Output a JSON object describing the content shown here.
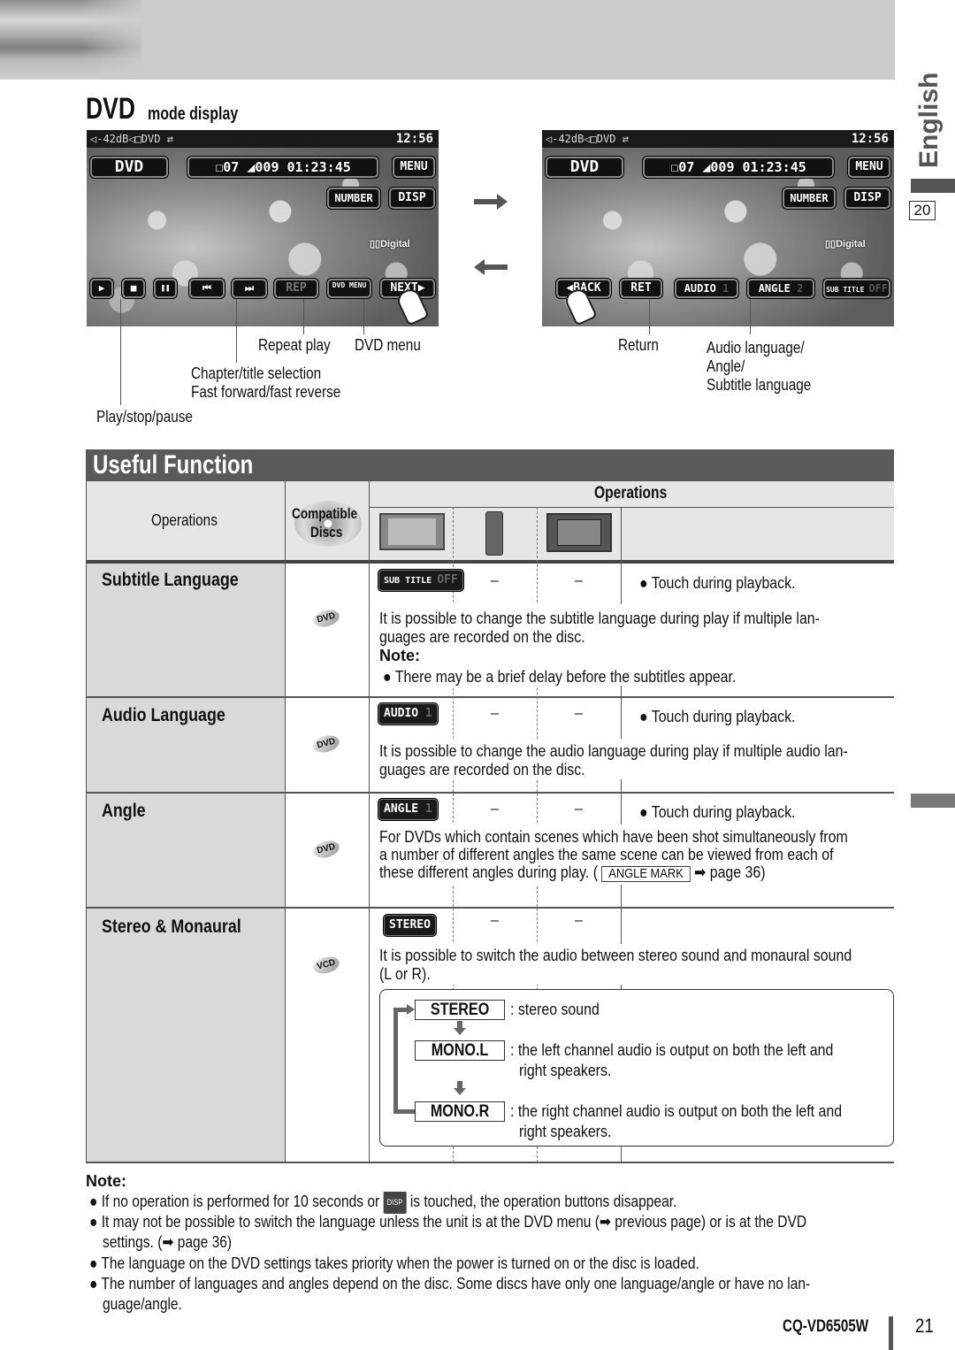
{
  "page": {
    "section_title": "DVD",
    "section_subtitle": "mode display",
    "side_tab_label": "English",
    "side_page_box": "20",
    "page_number": "21",
    "model": "CQ-VD6505W"
  },
  "screen_left": {
    "status": "◁-42dB◁□DVD ⇄",
    "clock": "12:56",
    "source_btn": "DVD",
    "info": "☐07  ◢009  01:23:45",
    "menu_btn": "MENU",
    "number_btn": "NUMBER",
    "disp_btn": "DISP",
    "digital": "▯▯Digital",
    "buttons": [
      "▶",
      "■",
      "❚❚",
      "⏮",
      "⏭",
      "REP",
      "DVD MENU",
      "NEXT▶"
    ]
  },
  "screen_right": {
    "status": "◁-42dB◁□DVD ⇄",
    "clock": "12:56",
    "source_btn": "DVD",
    "info": "☐07  ◢009  01:23:45",
    "menu_btn": "MENU",
    "number_btn": "NUMBER",
    "disp_btn": "DISP",
    "digital": "▯▯Digital",
    "back_btn": "◀BACK",
    "ret_btn": "RET",
    "audio_btn": "AUDIO",
    "audio_val": "1",
    "angle_btn": "ANGLE",
    "angle_val": "2",
    "sub_btn": "SUB TITLE",
    "sub_val": "OFF"
  },
  "callouts_left": {
    "repeat": "Repeat play",
    "dvd_menu": "DVD menu",
    "chapter1": "Chapter/title selection",
    "chapter2": "Fast forward/fast reverse",
    "play": "Play/stop/pause"
  },
  "callouts_right": {
    "return": "Return",
    "lang1": "Audio language/",
    "lang2": "Angle/",
    "lang3": "Subtitle language"
  },
  "useful": {
    "title": "Useful Function",
    "col_operations": "Operations",
    "col_discs_1": "Compatible",
    "col_discs_2": "Discs",
    "col_ops_header": "Operations",
    "dash": "–",
    "touch": "● Touch during playback.",
    "rows": [
      {
        "name": "Subtitle Language",
        "disc": "DVD",
        "button": "SUB TITLE",
        "button_val": "OFF",
        "desc1": "It is possible to change the subtitle language during play if multiple lan-",
        "desc2": "guages are recorded on the disc.",
        "note_label": "Note:",
        "note": "● There may be a brief delay before the subtitles appear."
      },
      {
        "name": "Audio Language",
        "disc": "DVD",
        "button": "AUDIO",
        "button_val": "1",
        "desc1": "It is possible to change the audio language during play if multiple audio lan-",
        "desc2": "guages are recorded on the disc."
      },
      {
        "name": "Angle",
        "disc": "DVD",
        "button": "ANGLE",
        "button_val": "1",
        "desc1": "For DVDs which contain scenes which have been shot simultaneously from",
        "desc2": "a number of different angles the same scene can be viewed from each of",
        "desc3_pre": "these different angles during play. (",
        "desc3_mark": "ANGLE MARK",
        "desc3_post": "➡ page 36)"
      },
      {
        "name": "Stereo & Monaural",
        "disc": "VCD",
        "button": "STEREO",
        "desc1": "It is possible to switch the audio between stereo sound and monaural sound",
        "desc2": "(L or R).",
        "modes": [
          {
            "label": "STEREO",
            "text1": ": stereo sound",
            "text2": ""
          },
          {
            "label": "MONO.L",
            "text1": ": the left channel audio is output on both the left and",
            "text2": "right speakers."
          },
          {
            "label": "MONO.R",
            "text1": ": the right channel audio is output on both the left and",
            "text2": "right speakers."
          }
        ]
      }
    ]
  },
  "notes": {
    "label": "Note:",
    "items": [
      {
        "pre": "● If no operation is performed for 10 seconds or ",
        "chip": "DISP",
        "post": " is touched, the operation buttons disappear."
      },
      {
        "line1": "● It may not be possible to switch the language unless the unit is at the DVD menu (➡ previous page) or is at the DVD",
        "line2": "settings. (➡ page 36)"
      },
      {
        "line1": "● The language on the DVD settings takes priority when the power is turned on or the disc is loaded."
      },
      {
        "line1": "● The number of languages and angles depend on the disc. Some discs have only one language/angle or have no lan-",
        "line2": "guage/angle."
      }
    ]
  }
}
